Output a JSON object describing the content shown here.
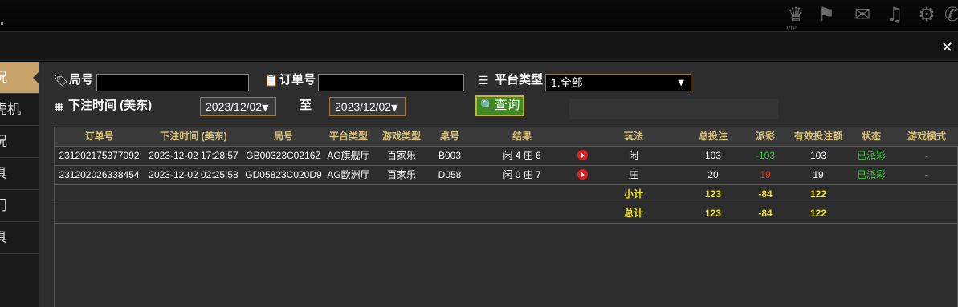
{
  "topbar": {
    "vip_label": "VIP",
    "icons": [
      "vip-crown-icon",
      "flag-icon",
      "chat-icon",
      "music-icon",
      "gear-icon",
      "message-icon"
    ]
  },
  "sidebar": {
    "items": [
      {
        "label": "况",
        "active": true
      },
      {
        "label": "虎机",
        "active": false
      },
      {
        "label": "况",
        "active": false
      },
      {
        "label": "具",
        "active": false
      },
      {
        "label": "门",
        "active": false
      },
      {
        "label": "具",
        "active": false
      }
    ]
  },
  "filters": {
    "round_label": "局号",
    "round_value": "",
    "order_label": "订单号",
    "order_value": "",
    "platform_label": "平台类型",
    "platform_selected": "1.全部",
    "time_label": "下注时间 (美东)",
    "date_from": "2023/12/02",
    "to_label": "至",
    "date_to": "2023/12/02",
    "query_label": "查询"
  },
  "table": {
    "headers": [
      "订单号",
      "下注时间 (美东)",
      "局号",
      "平台类型",
      "游戏类型",
      "桌号",
      "结果",
      "",
      "玩法",
      "总投注",
      "派彩",
      "有效投注额",
      "状态",
      "游戏模式"
    ],
    "rows": [
      {
        "order": "231202175377092",
        "time": "2023-12-02 17:28:57",
        "round": "GB00323C0216Z",
        "platform": "AG旗舰厅",
        "game": "百家乐",
        "table": "B003",
        "result": "闲 4 庄 6",
        "play": "闲",
        "bet": "103",
        "payout": "-103",
        "payout_color": "#3bd23b",
        "valid": "103",
        "status": "已派彩",
        "mode": "-"
      },
      {
        "order": "231202026338454",
        "time": "2023-12-02 02:25:58",
        "round": "GD05823C020D9",
        "platform": "AG欧洲厅",
        "game": "百家乐",
        "table": "D058",
        "result": "闲 0 庄 7",
        "play": "庄",
        "bet": "20",
        "payout": "19",
        "payout_color": "#e03a2a",
        "valid": "19",
        "status": "已派彩",
        "mode": "-"
      }
    ],
    "subtotal": {
      "label": "小计",
      "bet": "123",
      "payout": "-84",
      "valid": "122"
    },
    "total": {
      "label": "总计",
      "bet": "123",
      "payout": "-84",
      "valid": "122"
    }
  }
}
